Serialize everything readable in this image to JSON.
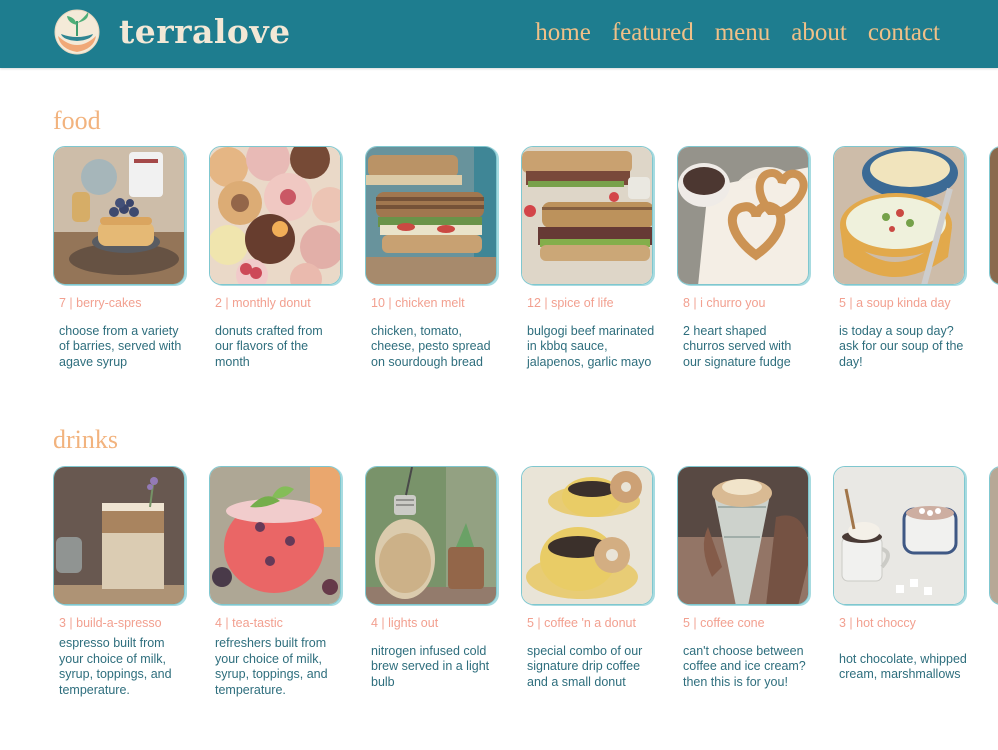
{
  "header": {
    "brand": "terralove",
    "nav": [
      "home",
      "featured",
      "menu",
      "about",
      "contact"
    ]
  },
  "sections": [
    {
      "title": "food",
      "items": [
        {
          "caption": "7 | berry-cakes",
          "desc": "choose from a variety of barries, served with agave syrup",
          "icon": "pancakes-image"
        },
        {
          "caption": "2 | monthly donut",
          "desc": "donuts crafted from our flavors of the month",
          "icon": "donuts-image"
        },
        {
          "caption": "10 | chicken melt",
          "desc": "chicken, tomato, cheese, pesto spread on sourdough bread",
          "icon": "sandwich-image"
        },
        {
          "caption": "12 | spice of life",
          "desc": "bulgogi beef marinated in kbbq sauce, jalapenos, garlic mayo",
          "icon": "bulgogi-sandwich-image"
        },
        {
          "caption": "8 | i churro you",
          "desc": "2 heart shaped churros served with our signature fudge",
          "icon": "churros-image"
        },
        {
          "caption": "5 | a soup kinda day",
          "desc": "is today a soup day? ask for our soup of the day!",
          "icon": "soup-image"
        }
      ]
    },
    {
      "title": "drinks",
      "items": [
        {
          "caption": "3 | build-a-spresso",
          "desc": "espresso built from your choice of milk, syrup, toppings, and temperature.",
          "icon": "iced-latte-image"
        },
        {
          "caption": "4 | tea-tastic",
          "desc": "refreshers built from your choice of milk, syrup, toppings, and temperature.",
          "icon": "berry-refresher-image"
        },
        {
          "caption": "4 | lights out",
          "desc": "nitrogen infused cold brew served in a light bulb",
          "icon": "lightbulb-drink-image"
        },
        {
          "caption": "5 | coffee 'n a donut",
          "desc": "special combo of our signature drip coffee and a small donut",
          "icon": "coffee-donut-image"
        },
        {
          "caption": "5 | coffee cone",
          "desc": "can't choose between coffee and ice cream? then this is for you!",
          "icon": "coffee-cone-image"
        },
        {
          "caption": "3 | hot choccy",
          "desc": "hot chocolate, whipped cream, marshmallows",
          "icon": "hot-chocolate-image"
        }
      ]
    }
  ]
}
